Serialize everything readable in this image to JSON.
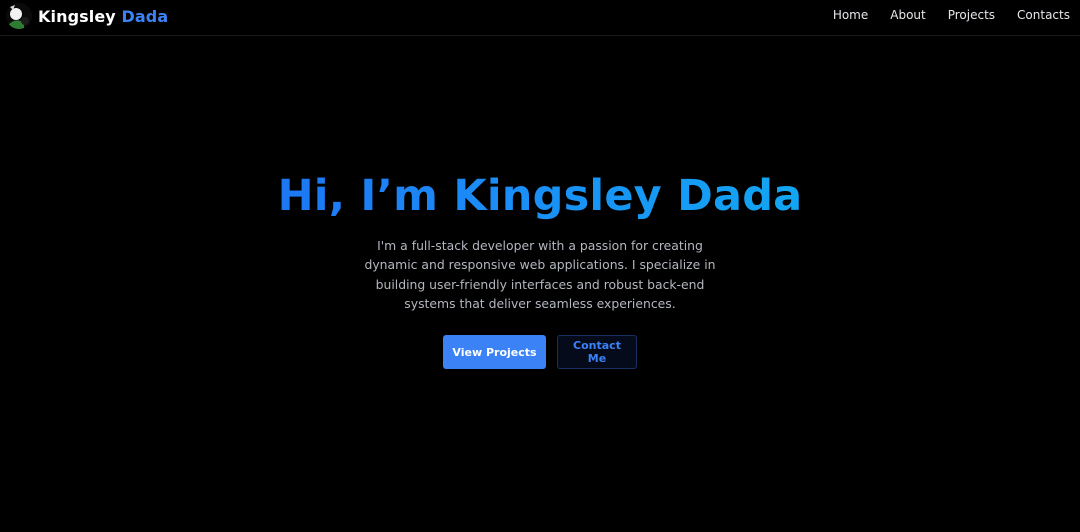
{
  "header": {
    "brand_first": "Kingsley",
    "brand_second": "Dada",
    "nav": {
      "home": "Home",
      "about": "About",
      "projects": "Projects",
      "contacts": "Contacts"
    }
  },
  "hero": {
    "title": "Hi, I’m Kingsley Dada",
    "description": "I'm a full-stack developer with a passion for creating dynamic and responsive web applications. I specialize in building user-friendly interfaces and robust back-end systems that deliver seamless experiences.",
    "primary_button": "View Projects",
    "secondary_button": "Contact Me"
  },
  "colors": {
    "background": "#000000",
    "accent": "#3b82f6",
    "gradient_start": "#1f5bf0",
    "gradient_end": "#0bbbf0",
    "nav_text": "#e5e7eb",
    "body_text": "#b3b7bf"
  },
  "icons": {
    "avatar": "profile-photo"
  }
}
